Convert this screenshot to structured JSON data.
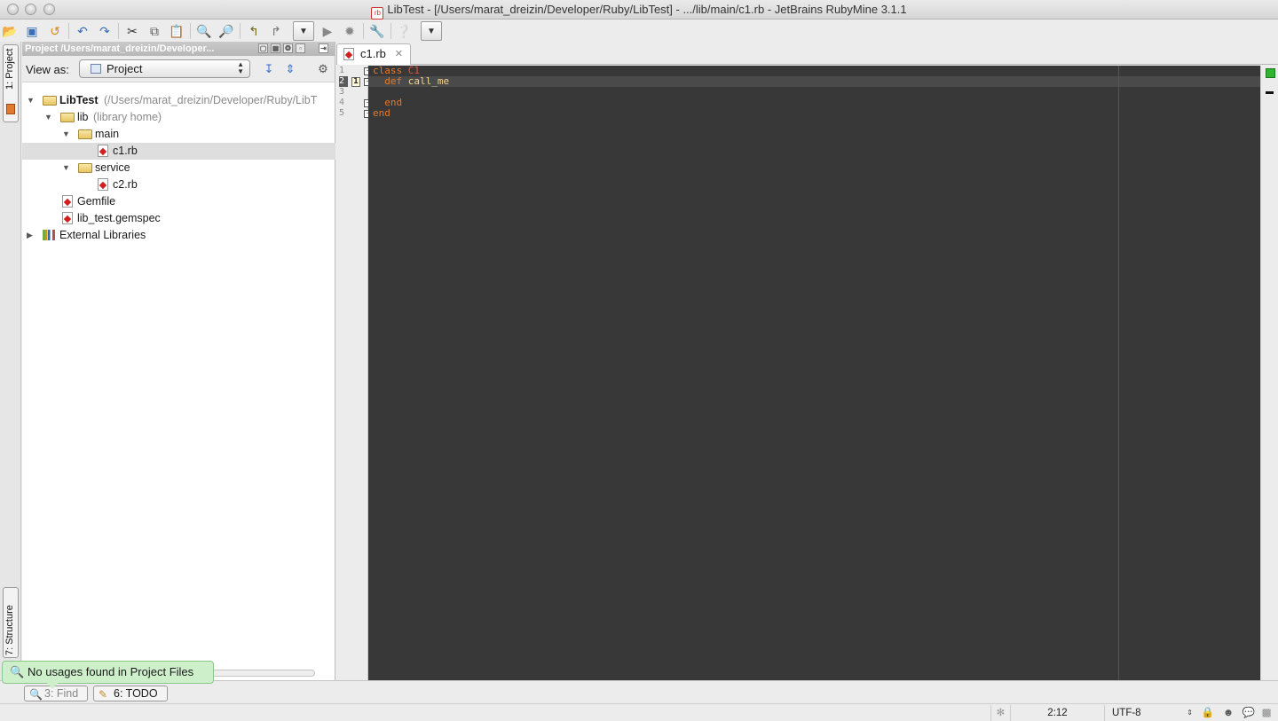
{
  "window": {
    "title": "LibTest - [/Users/marat_dreizin/Developer/Ruby/LibTest] - .../lib/main/c1.rb - JetBrains RubyMine 3.1.1",
    "title_icon": "rb"
  },
  "toolbar": {
    "icons": [
      "open-icon",
      "save-icon",
      "sync-icon",
      "undo-icon",
      "redo-icon",
      "cut-icon",
      "copy-icon",
      "paste-icon",
      "find-icon",
      "replace-icon",
      "back-icon",
      "forward-icon",
      "run-config-dropdown",
      "run-icon",
      "debug-icon",
      "settings-icon",
      "help-icon",
      "more-dropdown"
    ]
  },
  "left_stripe": {
    "project_tab": "1: Project",
    "structure_tab": "7: Structure"
  },
  "project_panel": {
    "header": "Project /Users/marat_dreizin/Developer...",
    "view_as_label": "View as:",
    "view_as_value": "Project",
    "tree": [
      {
        "label": "LibTest",
        "extra": "(/Users/marat_dreizin/Developer/Ruby/LibT",
        "type": "folder",
        "expanded": true,
        "depth": 0
      },
      {
        "label": "lib",
        "extra": "(library home)",
        "type": "folder",
        "expanded": true,
        "depth": 1
      },
      {
        "label": "main",
        "extra": "",
        "type": "folder",
        "expanded": true,
        "depth": 2
      },
      {
        "label": "c1.rb",
        "extra": "",
        "type": "ruby-file",
        "selected": true,
        "depth": 3
      },
      {
        "label": "service",
        "extra": "",
        "type": "folder",
        "expanded": true,
        "depth": 2
      },
      {
        "label": "c2.rb",
        "extra": "",
        "type": "ruby-file",
        "depth": 3
      },
      {
        "label": "Gemfile",
        "extra": "",
        "type": "ruby-file",
        "depth": 1
      },
      {
        "label": "lib_test.gemspec",
        "extra": "",
        "type": "ruby-file",
        "depth": 1
      },
      {
        "label": "External Libraries",
        "extra": "",
        "type": "library",
        "expanded": false,
        "depth": 0
      }
    ]
  },
  "editor": {
    "tab_label": "c1.rb",
    "line_numbers": [
      "1",
      "2",
      "3",
      "4",
      "5"
    ],
    "current_line": "2",
    "bookmark": "1",
    "lines": [
      {
        "kw": "class",
        "sep": " ",
        "name": "C1",
        "name_kind": "const"
      },
      {
        "kw": "  def",
        "sep": " ",
        "name": "call_me",
        "name_kind": "fn"
      },
      {
        "kw": "",
        "sep": "",
        "name": "",
        "name_kind": ""
      },
      {
        "kw": "  end",
        "sep": "",
        "name": "",
        "name_kind": ""
      },
      {
        "kw": "end",
        "sep": "",
        "name": "",
        "name_kind": ""
      }
    ],
    "colors": {
      "background": "#383838",
      "keyword": "#e07a30",
      "constant": "#e0553a",
      "method": "#f3d58f"
    }
  },
  "balloon": {
    "text": "No usages found in Project Files",
    "color": "#cdf0cb"
  },
  "bottom_tabs": {
    "find_label": "3: Find",
    "todo_label": "6: TODO"
  },
  "status": {
    "position": "2:12",
    "encoding": "UTF-8"
  }
}
